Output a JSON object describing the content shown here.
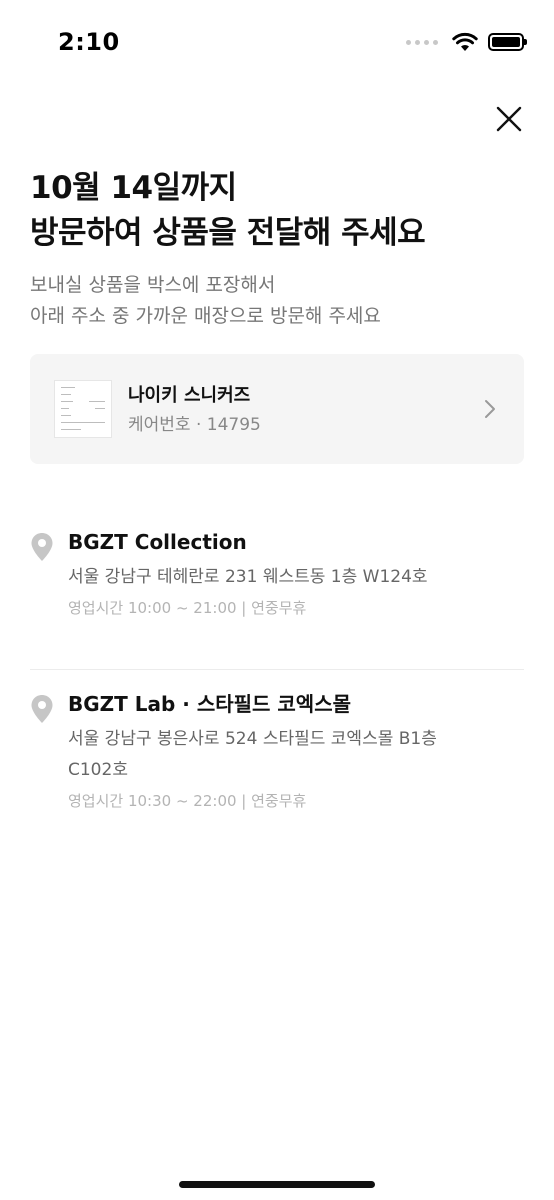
{
  "status_bar": {
    "time": "2:10"
  },
  "header": {
    "title_line1": "10월 14일까지",
    "title_line2": "방문하여 상품을 전달해 주세요",
    "subtitle_line1": "보내실 상품을 박스에 포장해서",
    "subtitle_line2": "아래 주소 중 가까운 매장으로 방문해 주세요"
  },
  "product": {
    "name": "나이키 스니커즈",
    "care_number": "케어번호 · 14795"
  },
  "stores": [
    {
      "name": "BGZT Collection",
      "address": "서울 강남구 테헤란로 231 웨스트동 1층 W124호",
      "hours": "영업시간 10:00 ~ 21:00 | 연중무휴"
    },
    {
      "name": "BGZT Lab · 스타필드 코엑스몰",
      "address_line1": "서울 강남구 봉은사로 524 스타필드 코엑스몰 B1층",
      "address_line2": "C102호",
      "hours": "영업시간 10:30 ~ 22:00 | 연중무휴"
    }
  ],
  "colors": {
    "text_primary": "#111111",
    "text_secondary": "#777777",
    "text_tertiary": "#b4b4b4",
    "card_background": "#f5f5f5",
    "pin_icon": "#c6c6c6"
  },
  "icons": {
    "close": "close-icon",
    "chevron": "chevron-right-icon",
    "pin": "location-pin-icon"
  }
}
